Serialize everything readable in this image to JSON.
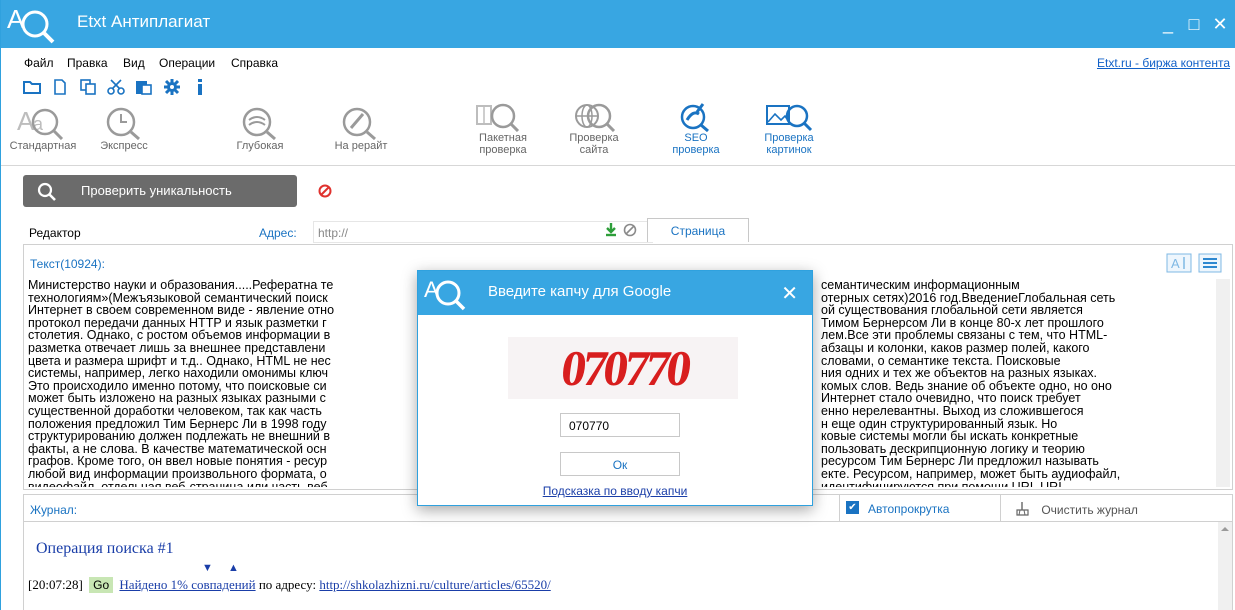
{
  "window": {
    "title": "Etxt Антиплагиат",
    "controls": {
      "minimize": "_",
      "maximize": "□",
      "close": "✕"
    }
  },
  "menu": {
    "items": [
      "Файл",
      "Правка",
      "Вид",
      "Операции",
      "Справка"
    ],
    "right_link": "Etxt.ru - биржа контента"
  },
  "small_toolbar": {
    "icons": [
      "folder-open-icon",
      "new-file-icon",
      "copy-icon",
      "cut-icon",
      "paste-icon",
      "gear-icon",
      "info-icon"
    ]
  },
  "tools": {
    "standard": "Стандартная",
    "express": "Экспресс",
    "deep": "Глубокая",
    "rewrite": "На рерайт",
    "batch": [
      "Пакетная",
      "проверка"
    ],
    "site": [
      "Проверка",
      "сайта"
    ],
    "seo": [
      "SEO",
      "проверка"
    ],
    "images": [
      "Проверка",
      "картинок"
    ]
  },
  "actions": {
    "check_label": "Проверить уникальность"
  },
  "editor": {
    "label": "Редактор",
    "address_label": "Адрес:",
    "address_placeholder": "http://",
    "page_tab": "Страница",
    "text_label": "Текст(10924):",
    "text_lines": [
      {
        "l": "Министерство науки и образования.....Рефератна те",
        "r": "семантическим информационным"
      },
      {
        "l": "технологиям»(Межъязыковой семантический поиск",
        "r": "отерных сетях)2016 год.ВведениеГлобальная сеть"
      },
      {
        "l": "Интернет в своем современном виде - явление отно",
        "r": "ой существования глобальной сети является"
      },
      {
        "l": "протокол передачи данных HTTP и язык разметки г",
        "r": "Тимом Бернерсом Ли в конце 80-х лет прошлого"
      },
      {
        "l": "столетия. Однако, с ростом объемов информации в",
        "r": "лем.Все эти проблемы связаны с тем, что HTML-"
      },
      {
        "l": "разметка отвечает лишь за внешнее представлени",
        "r": "абзацы и колонки, каков размер полей, какого"
      },
      {
        "l": "цвета и размера шрифт и т.д.. Однако, HTML не нес",
        "r": "словами, о семантике текста. Поисковые"
      },
      {
        "l": "системы, например, легко находили омонимы ключ",
        "r": "ния одних и тех же объектов на разных языках."
      },
      {
        "l": "Это происходило именно потому, что поисковые си",
        "r": "комых слов. Ведь знание об объекте одно, но оно"
      },
      {
        "l": "может быть изложено на разных языках разными с",
        "r": "Интернет стало очевидно, что поиск требует"
      },
      {
        "l": "существенной доработки человеком, так как часть",
        "r": "енно нерелевантны. Выход из сложившегося"
      },
      {
        "l": "положения предложил Тим Бернерс Ли в 1998 году",
        "r": "н еще один структурированный язык. Но"
      },
      {
        "l": "структурированию должен подлежать не внешний в",
        "r": "ковые системы могли бы искать конкретные"
      },
      {
        "l": "факты, а не слова. В качестве математической осн",
        "r": "пользовать дескрипционную логику  и теорию"
      },
      {
        "l": "графов. Кроме того, он ввел новые понятия  - ресур",
        "r": "ресурсом Тим Бернерс Ли предложил называть"
      },
      {
        "l": "любой вид информации произвольного формата, о",
        "r": "екте. Ресурсом, например, может быть аудиофайл,"
      },
      {
        "l": "видеофайл, отдельная веб-страница или часть веб",
        "r": "идентифицируются при помощи URI. URI -"
      }
    ]
  },
  "journal": {
    "label": "Журнал:",
    "autoscroll_label": "Автопрокрутка",
    "autoscroll_checked": true,
    "clear_label": "Очистить журнал",
    "operation_title": "Операция поиска #1",
    "arrows": "▼ ▲",
    "entry": {
      "time": "[20:07:28]",
      "go": "Go",
      "found": "Найдено 1% совпадений",
      "middle": " по адресу: ",
      "url": "http://shkolazhizni.ru/culture/articles/65520/"
    }
  },
  "dialog": {
    "title": "Введите капчу для Google",
    "captcha_text": "070770",
    "input_value": "070770",
    "ok_label": "Ок",
    "hint_link": "Подсказка по вводу капчи"
  },
  "colors": {
    "accent": "#38a6e2",
    "link": "#1a73c2",
    "captcha_red": "#d81e1e"
  }
}
